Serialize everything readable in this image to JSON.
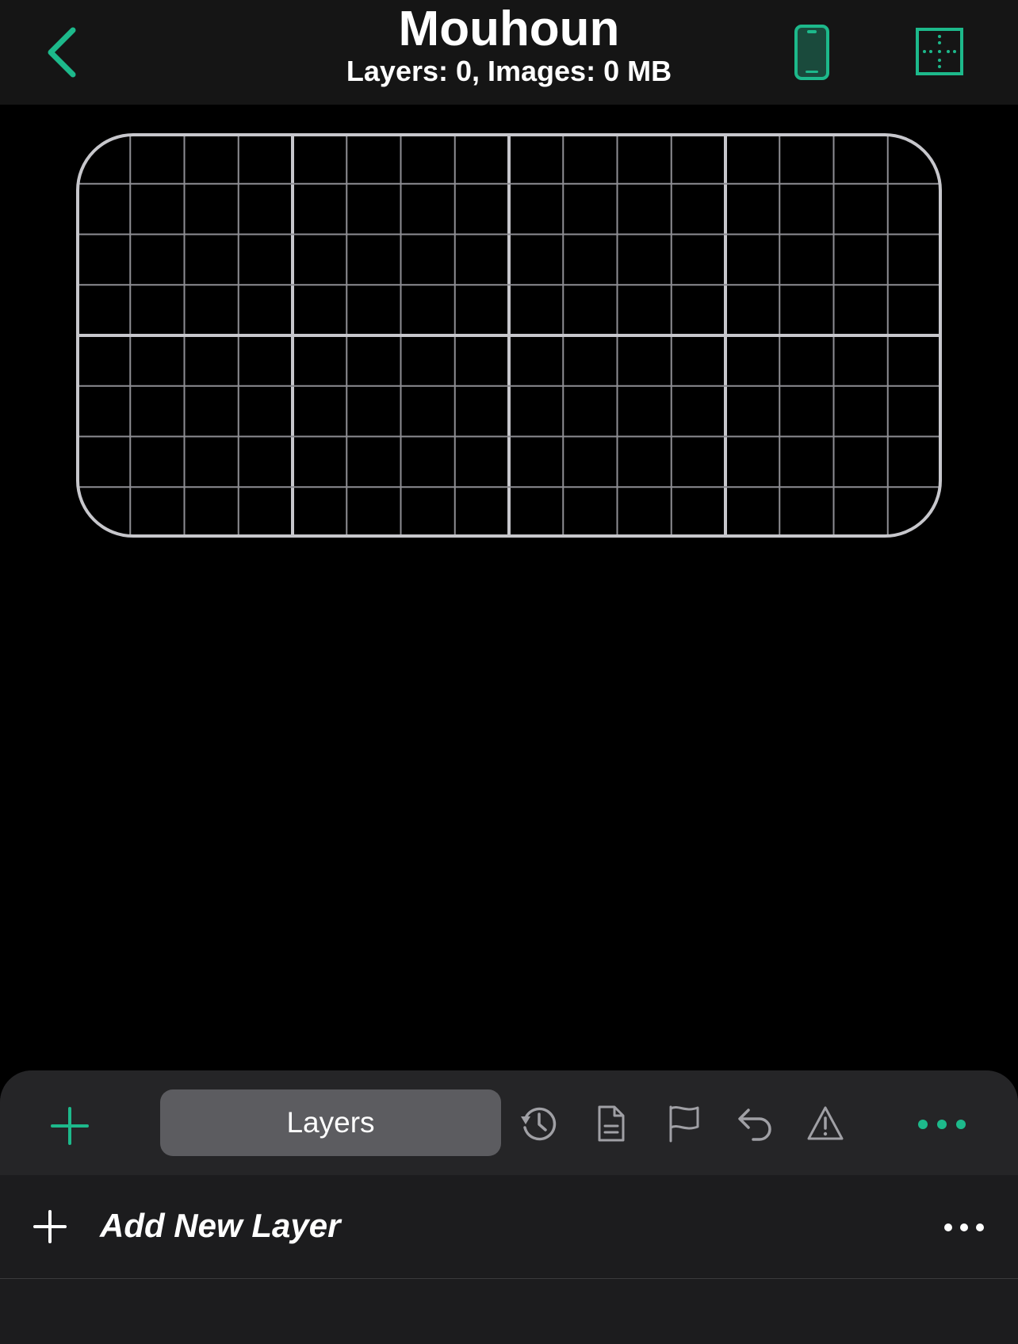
{
  "header": {
    "title": "Mouhoun",
    "subtitle": "Layers: 0, Images: 0 MB"
  },
  "colors": {
    "accent": "#1db98b",
    "header_bg": "#151515",
    "panel_bg": "#1c1c1e",
    "toolbar_bg": "#252527",
    "segment_bg": "#5c5c60",
    "icon_gray": "#a0a0a5",
    "grid_line": "#8e8e93",
    "grid_border": "#c7c7cc"
  },
  "icons": {
    "back": "chevron-left-icon",
    "device": "phone-icon",
    "grid": "grid-toggle-icon",
    "add": "plus-icon",
    "history": "history-icon",
    "document": "document-icon",
    "flag": "flag-icon",
    "undo": "undo-icon",
    "warning": "warning-icon",
    "more": "more-dots-icon"
  },
  "toolbar": {
    "selected_tab": "Layers"
  },
  "layers_list": {
    "add_label": "Add New Layer"
  }
}
